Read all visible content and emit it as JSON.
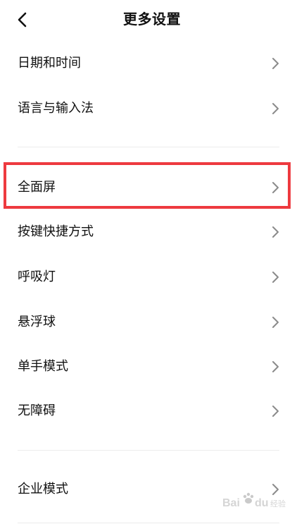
{
  "header": {
    "back_icon": "chevron-left-icon",
    "title": "更多设置"
  },
  "settings": {
    "date_time": "日期和时间",
    "language_input": "语言与输入法",
    "full_screen": "全面屏",
    "key_shortcuts": "按键快捷方式",
    "breathing_light": "呼吸灯",
    "floating_ball": "悬浮球",
    "one_hand_mode": "单手模式",
    "accessibility": "无障碍",
    "enterprise_mode": "企业模式"
  },
  "row_icon": "chevron-right-icon",
  "annotation": {
    "highlight_color": "#ee3a3f"
  },
  "watermark": {
    "text": "Baidu 经验"
  }
}
